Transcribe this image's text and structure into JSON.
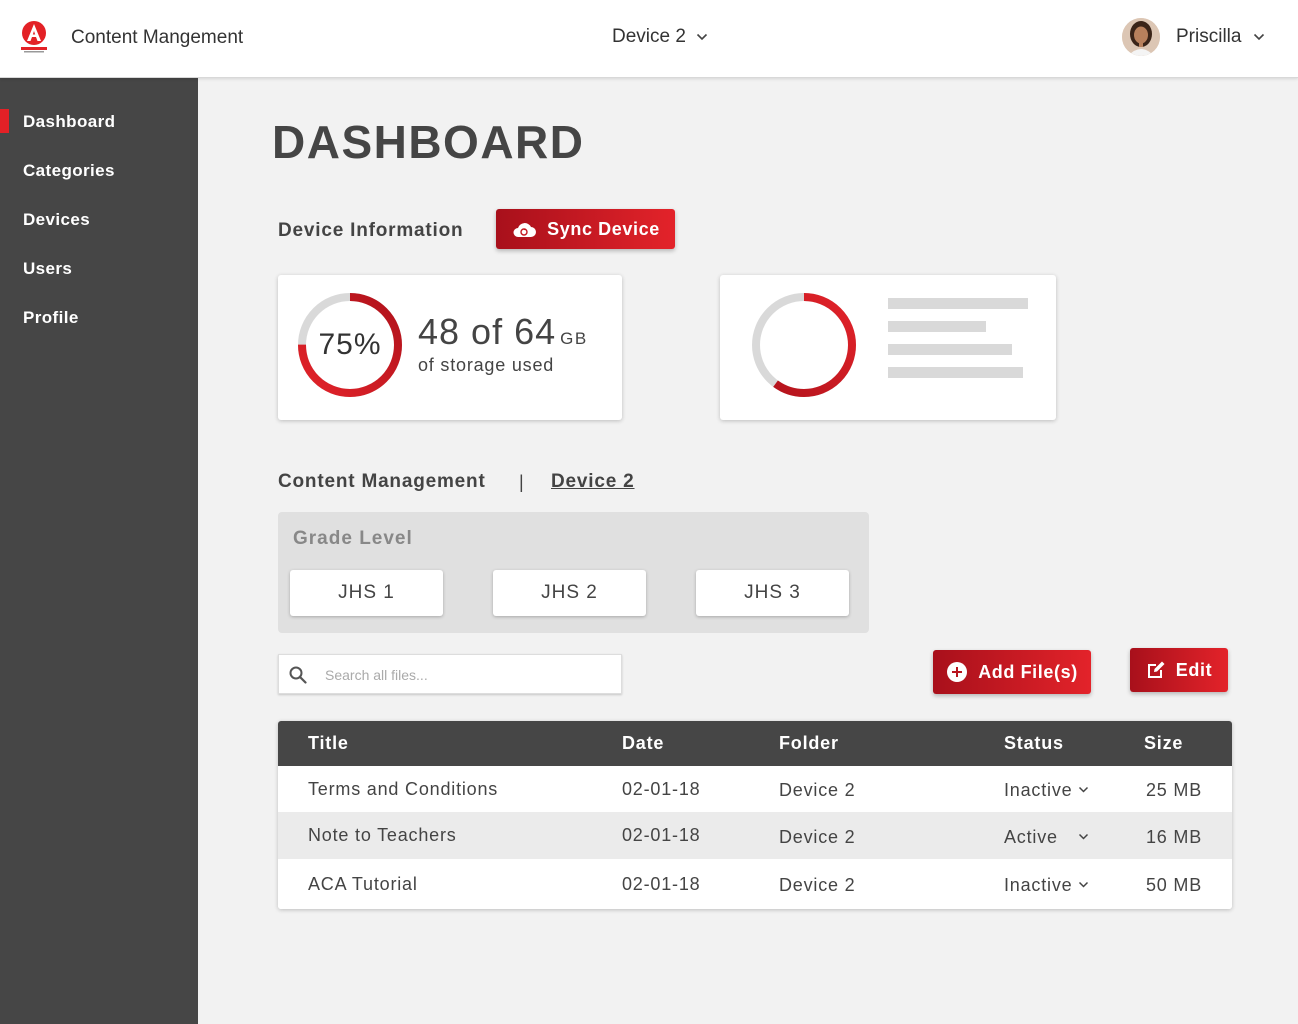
{
  "header": {
    "app_title": "Content Mangement",
    "device_selector": "Device 2",
    "user_name": "Priscilla"
  },
  "sidebar": {
    "items": [
      {
        "label": "Dashboard",
        "active": true
      },
      {
        "label": "Categories",
        "active": false
      },
      {
        "label": "Devices",
        "active": false
      },
      {
        "label": "Users",
        "active": false
      },
      {
        "label": "Profile",
        "active": false
      }
    ]
  },
  "main": {
    "page_title": "DASHBOARD",
    "device_info_label": "Device Information",
    "sync_button": "Sync Device",
    "storage": {
      "percent_label": "75%",
      "percent": 75,
      "used_text": "48 of 64",
      "unit": "GB",
      "sub": "of storage used"
    },
    "second_card_ring_percent": 60,
    "content_management_label": "Content Management",
    "breadcrumb_separator": "|",
    "breadcrumb_device": "Device 2",
    "grade_level": {
      "title": "Grade Level",
      "buttons": [
        "JHS 1",
        "JHS 2",
        "JHS 3"
      ]
    },
    "search": {
      "placeholder": "Search all files...",
      "value": ""
    },
    "add_files_button": "Add File(s)",
    "edit_button": "Edit",
    "table": {
      "columns": [
        "Title",
        "Date",
        "Folder",
        "Status",
        "Size"
      ],
      "rows": [
        {
          "title": "Terms and Conditions",
          "date": "02-01-18",
          "folder": "Device 2",
          "status": "Inactive",
          "size": "25 MB"
        },
        {
          "title": "Note to Teachers",
          "date": "02-01-18",
          "folder": "Device 2",
          "status": "Active",
          "size": "16 MB"
        },
        {
          "title": "ACA Tutorial",
          "date": "02-01-18",
          "folder": "Device 2",
          "status": "Inactive",
          "size": "50 MB"
        }
      ]
    }
  },
  "colors": {
    "accent": "#e32126",
    "accent_dark": "#a8101b",
    "sidebar": "#464646",
    "ring_track": "#d9d9d9",
    "background": "#f2f2f2"
  },
  "icons": {
    "logo": "asanka-logo",
    "sync": "cloud-sync-icon",
    "add": "plus-circle-icon",
    "edit": "edit-icon",
    "search": "search-icon",
    "dropdown": "chevron-down-icon"
  }
}
